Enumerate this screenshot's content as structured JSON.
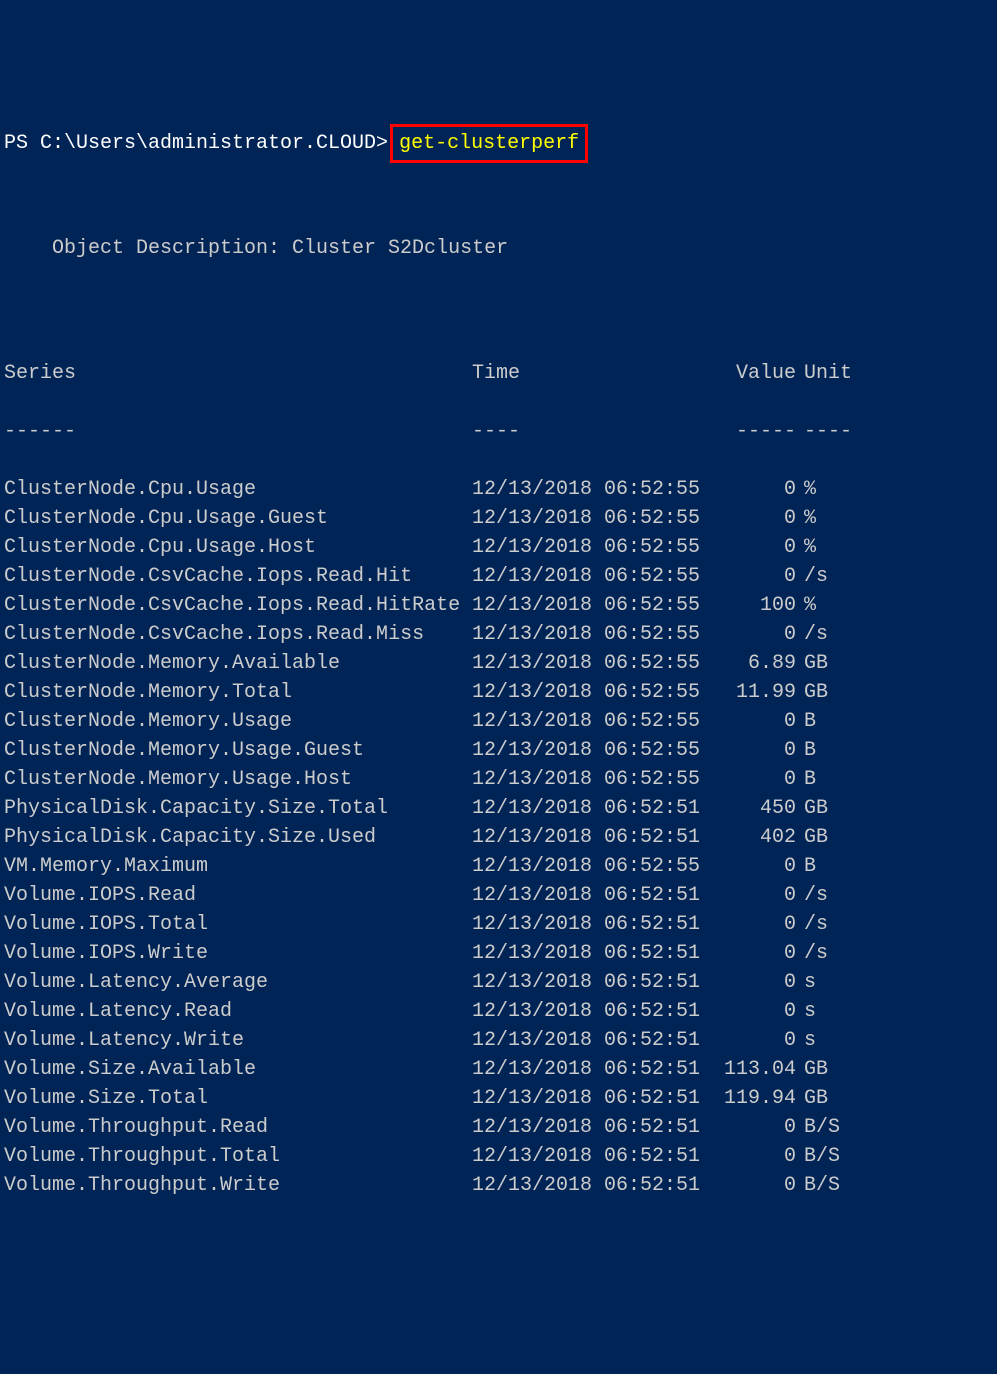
{
  "prompt": {
    "prefix": "PS C:\\Users\\administrator.CLOUD>",
    "command": "get-clusterperf"
  },
  "description": "Object Description: Cluster S2Dcluster",
  "table": {
    "headers": {
      "series": "Series",
      "time": "Time",
      "value": "Value",
      "unit": "Unit"
    },
    "dividers": {
      "series": "------",
      "time": "----",
      "value": "-----",
      "unit": "----"
    },
    "rows": [
      {
        "series": "ClusterNode.Cpu.Usage",
        "time": "12/13/2018 06:52:55",
        "value": "0",
        "unit": "%"
      },
      {
        "series": "ClusterNode.Cpu.Usage.Guest",
        "time": "12/13/2018 06:52:55",
        "value": "0",
        "unit": "%"
      },
      {
        "series": "ClusterNode.Cpu.Usage.Host",
        "time": "12/13/2018 06:52:55",
        "value": "0",
        "unit": "%"
      },
      {
        "series": "ClusterNode.CsvCache.Iops.Read.Hit",
        "time": "12/13/2018 06:52:55",
        "value": "0",
        "unit": "/s"
      },
      {
        "series": "ClusterNode.CsvCache.Iops.Read.HitRate",
        "time": "12/13/2018 06:52:55",
        "value": "100",
        "unit": "%"
      },
      {
        "series": "ClusterNode.CsvCache.Iops.Read.Miss",
        "time": "12/13/2018 06:52:55",
        "value": "0",
        "unit": "/s"
      },
      {
        "series": "ClusterNode.Memory.Available",
        "time": "12/13/2018 06:52:55",
        "value": "6.89",
        "unit": "GB"
      },
      {
        "series": "ClusterNode.Memory.Total",
        "time": "12/13/2018 06:52:55",
        "value": "11.99",
        "unit": "GB"
      },
      {
        "series": "ClusterNode.Memory.Usage",
        "time": "12/13/2018 06:52:55",
        "value": "0",
        "unit": "B"
      },
      {
        "series": "ClusterNode.Memory.Usage.Guest",
        "time": "12/13/2018 06:52:55",
        "value": "0",
        "unit": "B"
      },
      {
        "series": "ClusterNode.Memory.Usage.Host",
        "time": "12/13/2018 06:52:55",
        "value": "0",
        "unit": "B"
      },
      {
        "series": "PhysicalDisk.Capacity.Size.Total",
        "time": "12/13/2018 06:52:51",
        "value": "450",
        "unit": "GB"
      },
      {
        "series": "PhysicalDisk.Capacity.Size.Used",
        "time": "12/13/2018 06:52:51",
        "value": "402",
        "unit": "GB"
      },
      {
        "series": "VM.Memory.Maximum",
        "time": "12/13/2018 06:52:55",
        "value": "0",
        "unit": "B"
      },
      {
        "series": "Volume.IOPS.Read",
        "time": "12/13/2018 06:52:51",
        "value": "0",
        "unit": "/s"
      },
      {
        "series": "Volume.IOPS.Total",
        "time": "12/13/2018 06:52:51",
        "value": "0",
        "unit": "/s"
      },
      {
        "series": "Volume.IOPS.Write",
        "time": "12/13/2018 06:52:51",
        "value": "0",
        "unit": "/s"
      },
      {
        "series": "Volume.Latency.Average",
        "time": "12/13/2018 06:52:51",
        "value": "0",
        "unit": "s"
      },
      {
        "series": "Volume.Latency.Read",
        "time": "12/13/2018 06:52:51",
        "value": "0",
        "unit": "s"
      },
      {
        "series": "Volume.Latency.Write",
        "time": "12/13/2018 06:52:51",
        "value": "0",
        "unit": "s"
      },
      {
        "series": "Volume.Size.Available",
        "time": "12/13/2018 06:52:51",
        "value": "113.04",
        "unit": "GB"
      },
      {
        "series": "Volume.Size.Total",
        "time": "12/13/2018 06:52:51",
        "value": "119.94",
        "unit": "GB"
      },
      {
        "series": "Volume.Throughput.Read",
        "time": "12/13/2018 06:52:51",
        "value": "0",
        "unit": "B/S"
      },
      {
        "series": "Volume.Throughput.Total",
        "time": "12/13/2018 06:52:51",
        "value": "0",
        "unit": "B/S"
      },
      {
        "series": "Volume.Throughput.Write",
        "time": "12/13/2018 06:52:51",
        "value": "0",
        "unit": "B/S"
      }
    ]
  }
}
